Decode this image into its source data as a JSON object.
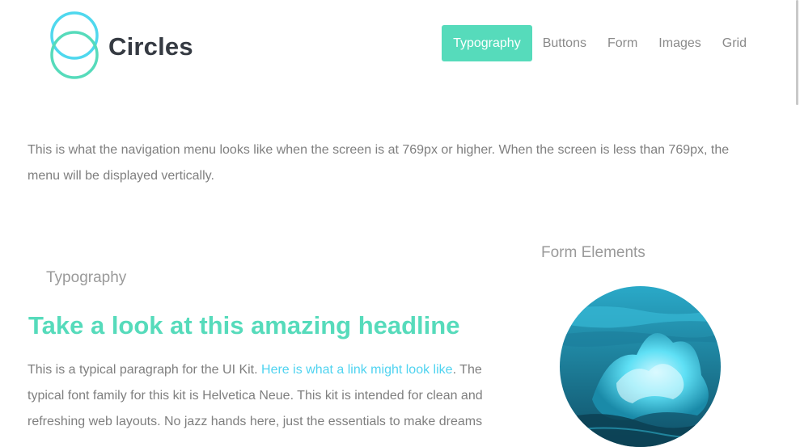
{
  "brand": {
    "name": "Circles",
    "accent": "#56dbbb",
    "logo_ring": "#4fd8ee"
  },
  "nav": {
    "items": [
      {
        "label": "Typography",
        "active": true
      },
      {
        "label": "Buttons"
      },
      {
        "label": "Form"
      },
      {
        "label": "Images"
      },
      {
        "label": "Grid"
      }
    ]
  },
  "intro": {
    "text": "This is what the navigation menu looks like when the screen is at 769px or higher. When the screen is less than 769px, the menu will be displayed vertically."
  },
  "typography": {
    "title": "Typography",
    "headline": "Take a look at this amazing headline",
    "paragraph_before_link": "This is a typical paragraph for the UI Kit. ",
    "link_text": "Here is what a link might look like",
    "paragraph_after_link": ". The typical font family for this kit is Helvetica Neue. This kit is intended for clean and refreshing web layouts. No jazz hands here, just the essentials to make dreams"
  },
  "form": {
    "title": "Form Elements"
  },
  "image": {
    "icon": "ocean-wave-image",
    "tint": "#3fd0ea"
  }
}
